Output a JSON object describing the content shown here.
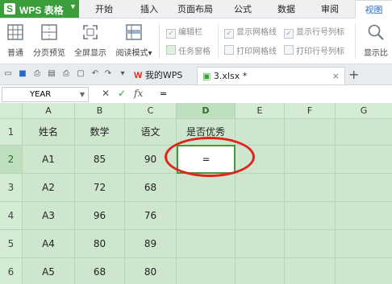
{
  "app": {
    "title": "WPS 表格",
    "logo": "S"
  },
  "ribbon_tabs": [
    "开始",
    "插入",
    "页面布局",
    "公式",
    "数据",
    "审阅",
    "视图"
  ],
  "active_tab": "视图",
  "ribbon": {
    "buttons": [
      "普通",
      "分页预览",
      "全屏显示",
      "阅读模式"
    ],
    "reading_mode_caret": "▾",
    "options": {
      "edit_bar": "编辑栏",
      "task_pane": "任务窗格",
      "show_gridlines": "显示网格线",
      "print_gridlines": "打印网格线",
      "show_headers": "显示行号列标",
      "print_headers": "打印行号列标"
    },
    "zoom_label": "显示比"
  },
  "doc_tabs": {
    "home": "我的WPS",
    "file": "3.xlsx *",
    "close": "×",
    "new": "+"
  },
  "formula_bar": {
    "name_box": "YEAR",
    "cancel": "✕",
    "confirm": "✓",
    "fx": "fx",
    "value": "="
  },
  "sheet": {
    "columns": [
      "A",
      "B",
      "C",
      "D",
      "E",
      "F",
      "G"
    ],
    "rows": [
      {
        "num": "1",
        "cells": [
          "姓名",
          "数学",
          "语文",
          "是否优秀"
        ]
      },
      {
        "num": "2",
        "cells": [
          "A1",
          "85",
          "90",
          "="
        ]
      },
      {
        "num": "3",
        "cells": [
          "A2",
          "72",
          "68",
          ""
        ]
      },
      {
        "num": "4",
        "cells": [
          "A3",
          "96",
          "76",
          ""
        ]
      },
      {
        "num": "5",
        "cells": [
          "A4",
          "80",
          "89",
          ""
        ]
      },
      {
        "num": "6",
        "cells": [
          "A5",
          "68",
          "80",
          ""
        ]
      }
    ],
    "active_cell": "D2"
  },
  "colors": {
    "brand": "#3b9e3b",
    "annotation": "#e0241b",
    "sheet_bg": "#cde6cd"
  }
}
